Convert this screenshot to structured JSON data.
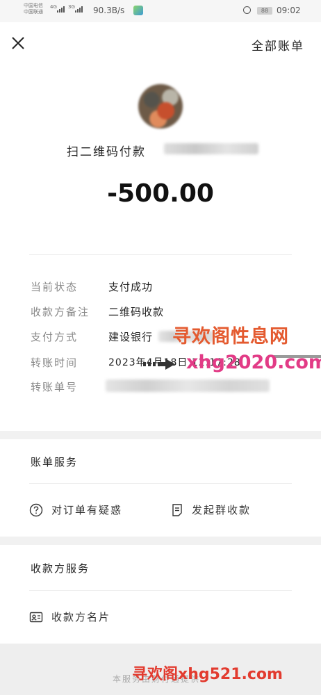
{
  "statusbar": {
    "carrier1": "中国电信",
    "carrier2": "中国联通",
    "sig1": "4G",
    "sig2": "3G",
    "speed": "90.3B/s",
    "battery": "88",
    "time": "09:02"
  },
  "header": {
    "close_icon": "close-icon",
    "all_bills": "全部账单"
  },
  "summary": {
    "payment_title": "扫二维码付款",
    "amount": "-500.00"
  },
  "details": [
    {
      "label": "当前状态",
      "value": "支付成功"
    },
    {
      "label": "收款方备注",
      "value": "二维码收款"
    },
    {
      "label": "支付方式",
      "value": "建设银行"
    },
    {
      "label": "转账时间",
      "value": "2023年4月18日 12:17:28"
    },
    {
      "label": "转账单号",
      "value": ""
    }
  ],
  "watermark": {
    "line1": "寻欢阁性息网",
    "line2": "xhg2020.com",
    "line3": "寻欢阁xhg521.com"
  },
  "bill_service": {
    "title": "账单服务",
    "items": [
      {
        "icon": "question-circle-icon",
        "label": "对订单有疑惑"
      },
      {
        "icon": "document-icon",
        "label": "发起群收款"
      }
    ]
  },
  "payee_service": {
    "title": "收款方服务",
    "items": [
      {
        "icon": "contact-card-icon",
        "label": "收款方名片"
      }
    ]
  },
  "footer": {
    "text": "本服务由财付通提供"
  },
  "colors": {
    "watermark_orange": "#e45a2f",
    "watermark_pink": "#e23b86",
    "section_gap": "#f1f1f1"
  }
}
